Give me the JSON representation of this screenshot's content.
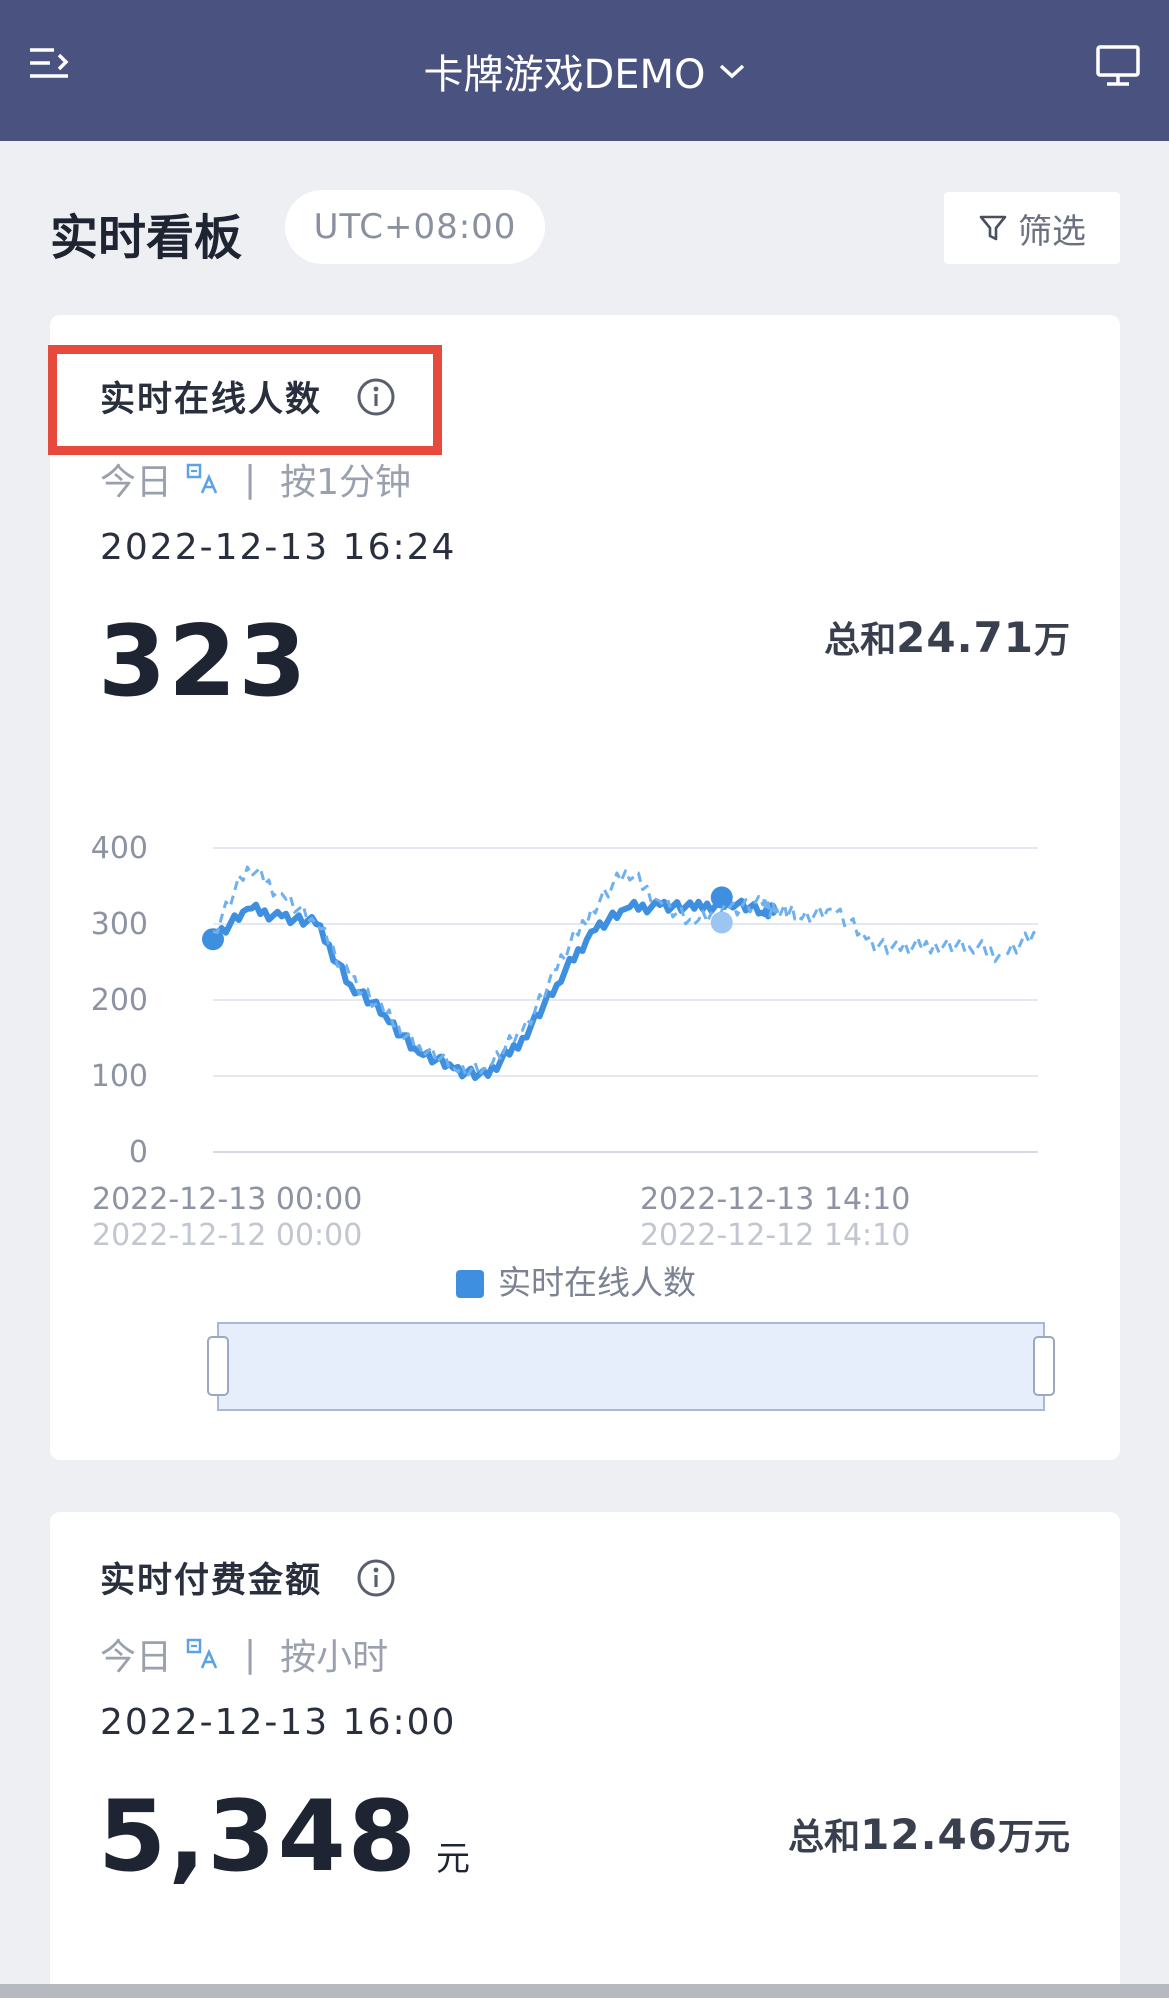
{
  "topbar": {
    "app_title": "卡牌游戏DEMO"
  },
  "page": {
    "title": "实时看板",
    "timezone": "UTC+08:00",
    "filter_label": "筛选"
  },
  "online_card": {
    "title": "实时在线人数",
    "period_label": "今日",
    "granularity_label": "按1分钟",
    "timestamp": "2022-12-13 16:24",
    "value": "323",
    "total_prefix": "总和",
    "total_value": "24.71",
    "total_suffix": "万"
  },
  "payment_card": {
    "title": "实时付费金额",
    "period_label": "今日",
    "granularity_label": "按小时",
    "timestamp": "2022-12-13 16:00",
    "value": "5,348",
    "unit": "元",
    "total_prefix": "总和",
    "total_value": "12.46",
    "total_suffix": "万元"
  },
  "chart_data": {
    "type": "line",
    "title": "",
    "xlabel": "",
    "ylabel": "",
    "ylim": [
      0,
      400
    ],
    "yticks": [
      "0",
      "100",
      "200",
      "300",
      "400"
    ],
    "x_tick_labels_current": [
      "2022-12-13 00:00",
      "2022-12-13 14:10"
    ],
    "x_tick_labels_compare": [
      "2022-12-12 00:00",
      "2022-12-12 14:10"
    ],
    "x_hours": [
      0,
      1,
      2,
      3,
      4,
      5,
      6,
      7,
      8,
      9,
      10,
      11,
      12,
      13,
      14,
      15,
      16,
      16.4,
      17,
      18,
      19,
      20,
      21,
      22,
      23,
      24
    ],
    "series": [
      {
        "name": "实时在线人数",
        "color": "#3f8fe0",
        "style": "solid",
        "values": [
          280,
          320,
          310,
          300,
          220,
          180,
          130,
          110,
          100,
          150,
          220,
          290,
          320,
          325,
          320,
          330,
          315,
          323,
          null,
          null,
          null,
          null,
          null,
          null,
          null,
          null
        ]
      },
      {
        "name": "",
        "color": "#6fb0ef",
        "style": "dashed",
        "values": [
          290,
          375,
          340,
          300,
          230,
          180,
          140,
          110,
          110,
          160,
          240,
          320,
          370,
          330,
          300,
          320,
          325,
          320,
          310,
          320,
          280,
          265,
          275,
          270,
          260,
          290
        ]
      }
    ],
    "grid": true,
    "legend": "bottom-center"
  }
}
